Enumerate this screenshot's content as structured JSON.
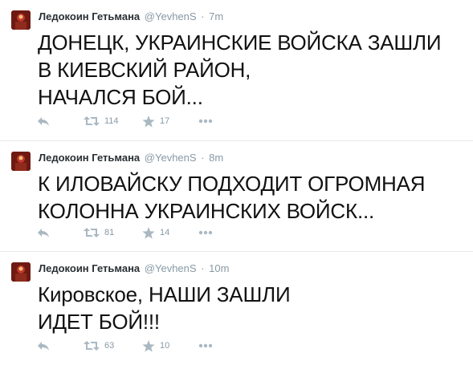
{
  "tweets": [
    {
      "author_name": "Ледокоин Гетьмана",
      "handle": "@YevhenS",
      "separator": "·",
      "time": "7m",
      "lines": [
        "ДОНЕЦК, УКРАИНСКИЕ ВОЙСКА ЗАШЛИ",
        "В КИЕВСКИЙ РАЙОН,",
        "НАЧАЛСЯ БОЙ..."
      ],
      "retweets": "114",
      "favorites": "17"
    },
    {
      "author_name": "Ледокоин Гетьмана",
      "handle": "@YevhenS",
      "separator": "·",
      "time": "8m",
      "lines": [
        "К ИЛОВАЙСКУ ПОДХОДИТ ОГРОМНАЯ",
        "КОЛОННА УКРАИНСКИХ ВОЙСК..."
      ],
      "retweets": "81",
      "favorites": "14"
    },
    {
      "author_name": "Ледокоин Гетьмана",
      "handle": "@YevhenS",
      "separator": "·",
      "time": "10m",
      "lines": [
        "Кировское, НАШИ ЗАШЛИ",
        "ИДЕТ БОЙ!!!"
      ],
      "retweets": "63",
      "favorites": "10"
    }
  ],
  "icons": {
    "reply": "reply-icon",
    "retweet": "retweet-icon",
    "favorite": "star-icon",
    "more": "more-dots-icon"
  },
  "colors": {
    "icon_gray": "#aab8c2",
    "meta_gray": "#8899a6",
    "divider": "#e8eaec"
  }
}
